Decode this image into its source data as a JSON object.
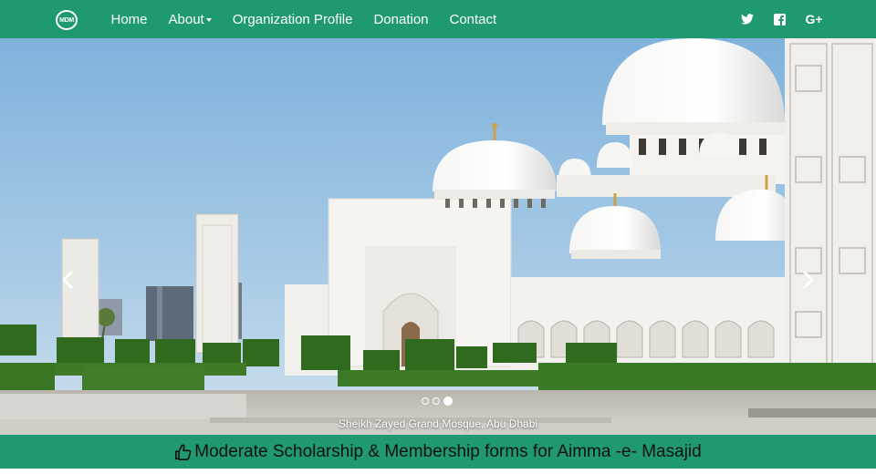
{
  "navbar": {
    "logo_text": "MDM",
    "links": [
      {
        "label": "Home"
      },
      {
        "label": "About"
      },
      {
        "label": "Organization Profile"
      },
      {
        "label": "Donation"
      },
      {
        "label": "Contact"
      }
    ],
    "social_icons": [
      "twitter-icon",
      "facebook-icon",
      "google-plus-icon"
    ],
    "google_plus_label": "G+"
  },
  "carousel": {
    "caption": "Sheikh Zayed Grand Mosque, Abu Dhabi",
    "slide_count": 3,
    "active_index": 2,
    "controls": [
      "chevron-left-icon",
      "chevron-right-icon"
    ]
  },
  "banner": {
    "icon": "thumbs-up-icon",
    "text": "Moderate Scholarship & Membership forms for Aimma -e- Masajid"
  },
  "colors": {
    "brand_green": "#1e9a6e",
    "nav_text": "#ffffff",
    "banner_text": "#111111"
  }
}
